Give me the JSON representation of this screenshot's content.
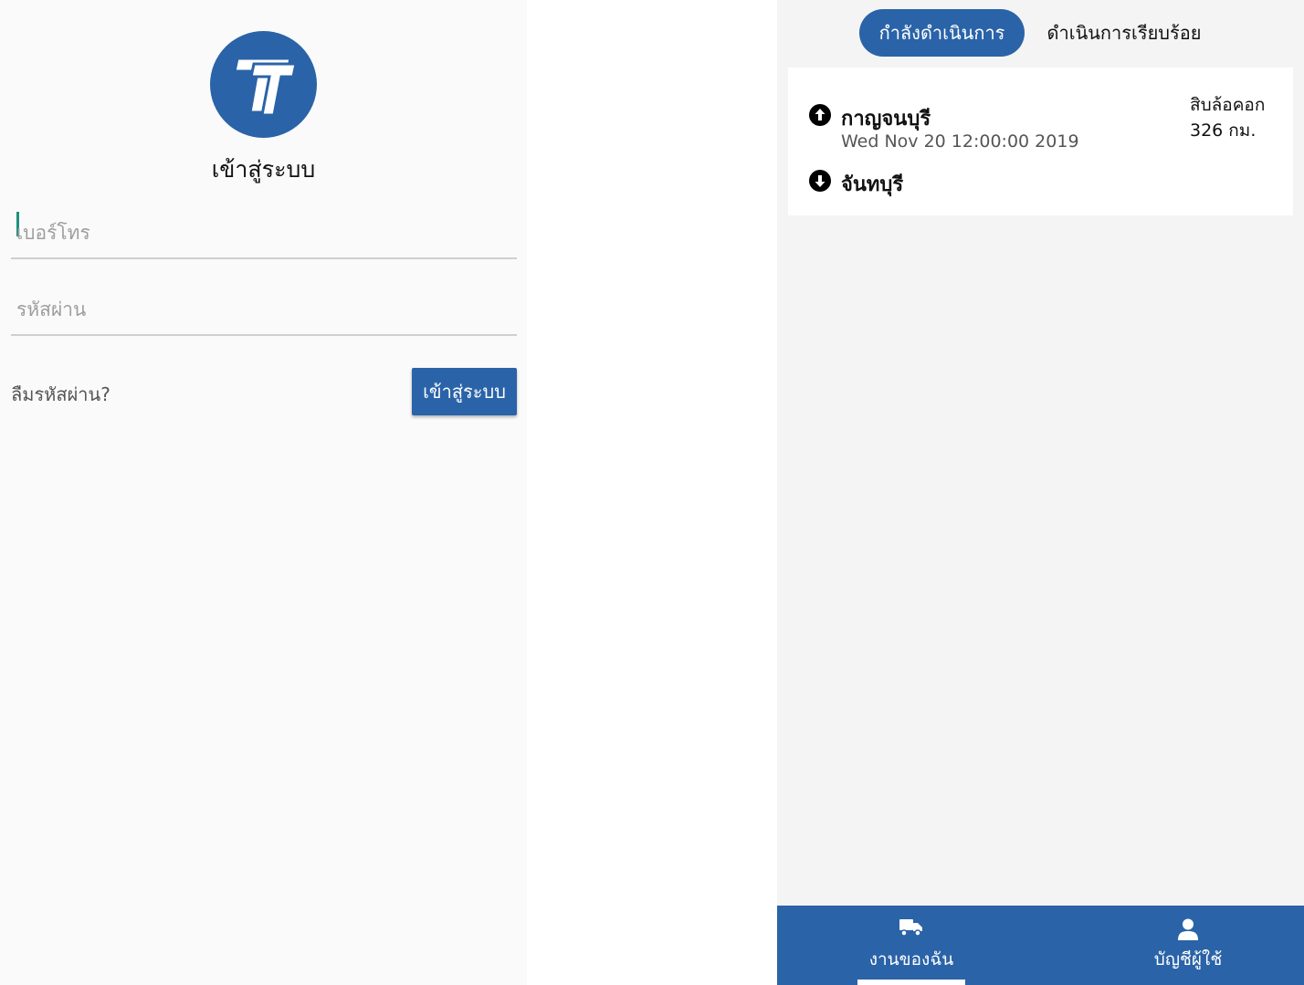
{
  "login": {
    "title": "เข้าสู่ระบบ",
    "phone_placeholder": "เบอร์โทร",
    "password_placeholder": "รหัสผ่าน",
    "forgot_label": "ลืมรหัสผ่าน?",
    "login_button_label": "เข้าสู่ระบบ"
  },
  "jobs": {
    "tabs": [
      {
        "label": "กำลังดำเนินการ",
        "active": true
      },
      {
        "label": "ดำเนินการเรียบร้อย",
        "active": false
      }
    ],
    "card": {
      "origin": "กาญจนบุรี",
      "datetime": "Wed Nov 20 12:00:00 2019",
      "destination": "จันทบุรี",
      "vehicle": "สิบล้อคอก",
      "distance": "326 กม."
    },
    "nav": {
      "jobs_label": "งานของฉัน",
      "account_label": "บัญชีผู้ใช้",
      "active": "jobs"
    }
  },
  "icons": {
    "logo": "tt-logo-icon",
    "origin": "arrow-up-circle-icon",
    "destination": "arrow-down-circle-icon",
    "jobs": "truck-icon",
    "account": "user-icon"
  },
  "colors": {
    "primary": "#2a63a8",
    "caret": "#1f8f7f"
  }
}
